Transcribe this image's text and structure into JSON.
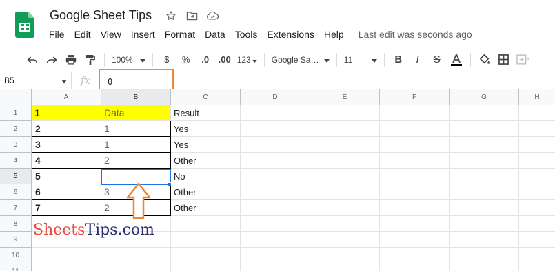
{
  "header": {
    "title": "Google Sheet Tips",
    "last_edit": "Last edit was seconds ago",
    "menu": [
      "File",
      "Edit",
      "View",
      "Insert",
      "Format",
      "Data",
      "Tools",
      "Extensions",
      "Help"
    ]
  },
  "toolbar": {
    "zoom": "100%",
    "currency": "$",
    "percent": "%",
    "decrease_decimal": ".0",
    "increase_decimal": ".00",
    "more_formats": "123",
    "font": "Google Sa…",
    "font_size": "11"
  },
  "formula_bar": {
    "name_box": "B5",
    "fx": "fx",
    "value": "0"
  },
  "grid": {
    "columns": [
      "A",
      "B",
      "C",
      "D",
      "E",
      "F",
      "G",
      "H"
    ],
    "rows": [
      "1",
      "2",
      "3",
      "4",
      "5",
      "6",
      "7",
      "8",
      "9",
      "10",
      "11"
    ],
    "table": [
      [
        "1",
        "Data",
        "Result"
      ],
      [
        "2",
        "1",
        "Yes"
      ],
      [
        "3",
        "1",
        "Yes"
      ],
      [
        "4",
        "2",
        "Other"
      ],
      [
        "5",
        "-",
        "No"
      ],
      [
        "6",
        "3",
        "Other"
      ],
      [
        "7",
        "2",
        "Other"
      ]
    ],
    "active_cell": "B5"
  },
  "watermark": {
    "part1": "Sheets",
    "part2": "Tips",
    "part3": ".com"
  },
  "colors": {
    "header_fill": "#ffff00",
    "selection": "#1a73e8",
    "highlight": "#ee8733",
    "sheets_green": "#0f9d58"
  },
  "icons": [
    "sheets-logo-icon",
    "star-icon",
    "move-to-folder-icon",
    "cloud-status-icon",
    "undo-icon",
    "redo-icon",
    "print-icon",
    "paint-format-icon",
    "bold-icon",
    "italic-icon",
    "strikethrough-icon",
    "text-color-icon",
    "fill-color-icon",
    "borders-icon",
    "merge-cells-icon",
    "up-arrow-annotation-icon"
  ]
}
